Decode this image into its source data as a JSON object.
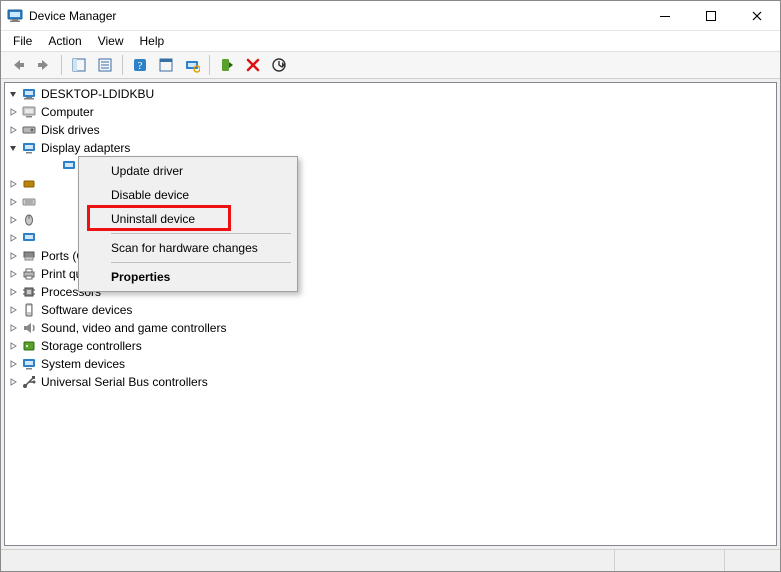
{
  "window": {
    "title": "Device Manager"
  },
  "menu": {
    "file": "File",
    "action": "Action",
    "view": "View",
    "help": "Help"
  },
  "tree": {
    "root": "DESKTOP-LDIDKBU",
    "categories": [
      "Computer",
      "Disk drives",
      "Display adapters",
      "",
      "",
      "",
      "",
      "",
      "Ports (COM & LPT)",
      "Print queues",
      "Processors",
      "Software devices",
      "Sound, video and game controllers",
      "Storage controllers",
      "System devices",
      "Universal Serial Bus controllers"
    ]
  },
  "context_menu": {
    "update_driver": "Update driver",
    "disable_device": "Disable device",
    "uninstall_device": "Uninstall device",
    "scan_hardware": "Scan for hardware changes",
    "properties": "Properties"
  }
}
